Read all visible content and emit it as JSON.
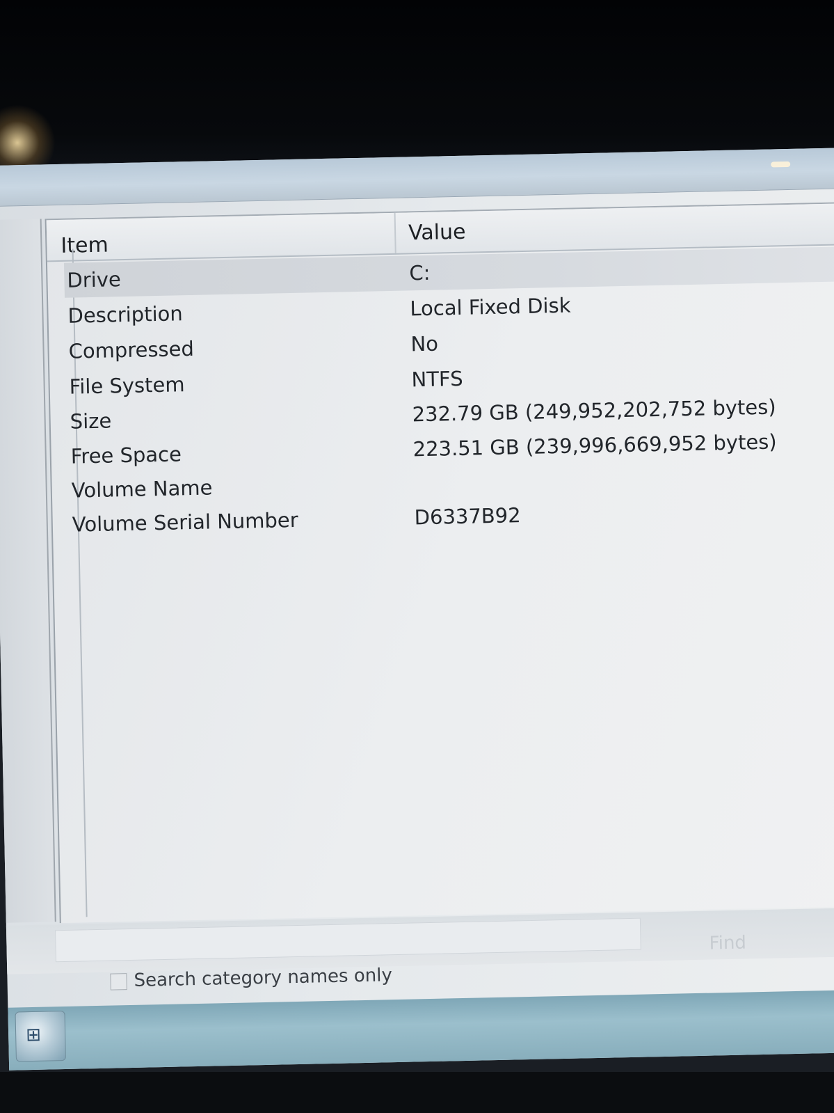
{
  "table": {
    "columns": {
      "item": "Item",
      "value": "Value"
    },
    "rows": [
      {
        "item": "Drive",
        "value": "C:"
      },
      {
        "item": "Description",
        "value": "Local Fixed Disk"
      },
      {
        "item": "Compressed",
        "value": "No"
      },
      {
        "item": "File System",
        "value": "NTFS"
      },
      {
        "item": "Size",
        "value": "232.79 GB (249,952,202,752 bytes)"
      },
      {
        "item": "Free Space",
        "value": "223.51 GB (239,996,669,952 bytes)"
      },
      {
        "item": "Volume Name",
        "value": ""
      },
      {
        "item": "Volume Serial Number",
        "value": "D6337B92"
      }
    ]
  },
  "search": {
    "find_label": "Find",
    "category_only_label": "Search category names only"
  },
  "colors": {
    "selection": "#d3d7dc",
    "taskbar": "#8fb3c2"
  }
}
